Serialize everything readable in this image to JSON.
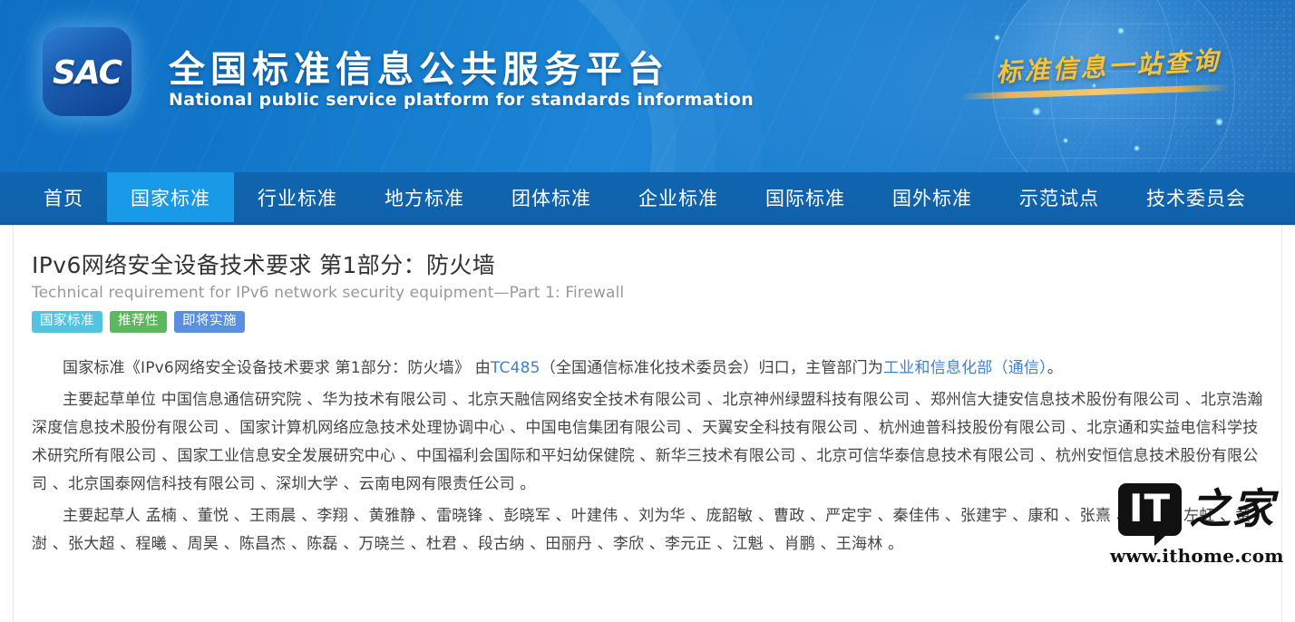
{
  "header": {
    "logo_text": "SAC",
    "title_cn": "全国标准信息公共服务平台",
    "title_en": "National public service platform  for standards information",
    "slogan_cn": "标准信息一站查询"
  },
  "nav": {
    "items": [
      {
        "label": "首页",
        "active": false
      },
      {
        "label": "国家标准",
        "active": true
      },
      {
        "label": "行业标准",
        "active": false
      },
      {
        "label": "地方标准",
        "active": false
      },
      {
        "label": "团体标准",
        "active": false
      },
      {
        "label": "企业标准",
        "active": false
      },
      {
        "label": "国际标准",
        "active": false
      },
      {
        "label": "国外标准",
        "active": false
      },
      {
        "label": "示范试点",
        "active": false
      },
      {
        "label": "技术委员会",
        "active": false
      }
    ]
  },
  "document": {
    "title": "IPv6网络安全设备技术要求 第1部分：防火墙",
    "subtitle": "Technical requirement for IPv6 network security equipment—Part 1: Firewall",
    "badges": [
      {
        "label": "国家标准",
        "color": "#52c3e0"
      },
      {
        "label": "推荐性",
        "color": "#5cb85c"
      },
      {
        "label": "即将实施",
        "color": "#5b8fe0"
      }
    ],
    "paragraphs": [
      {
        "name": "scope-paragraph",
        "segments": [
          {
            "text": "国家标准《IPv6网络安全设备技术要求 第1部分：防火墙》 由",
            "link": false
          },
          {
            "text": "TC485",
            "link": true
          },
          {
            "text": "（全国通信标准化技术委员会）归口，主管部门为",
            "link": false
          },
          {
            "text": "工业和信息化部（通信）",
            "link": true
          },
          {
            "text": "。",
            "link": false
          }
        ]
      },
      {
        "name": "drafting-organizations-paragraph",
        "segments": [
          {
            "text": "主要起草单位 中国信息通信研究院 、华为技术有限公司 、北京天融信网络安全技术有限公司 、北京神州绿盟科技有限公司 、郑州信大捷安信息技术股份有限公司 、北京浩瀚深度信息技术股份有限公司 、国家计算机网络应急技术处理协调中心 、中国电信集团有限公司 、天翼安全科技有限公司 、杭州迪普科技股份有限公司 、北京通和实益电信科学技术研究所有限公司 、国家工业信息安全发展研究中心 、中国福利会国际和平妇幼保健院 、新华三技术有限公司 、北京可信华泰信息技术有限公司 、杭州安恒信息技术股份有限公司 、北京国泰网信科技有限公司 、深圳大学 、云南电网有限责任公司 。",
            "link": false
          }
        ]
      },
      {
        "name": "drafters-paragraph",
        "segments": [
          {
            "text": "主要起草人 孟楠 、董悦 、王雨晨 、李翔 、黄雅静 、雷晓锋 、彭晓军 、叶建伟 、刘为华 、庞韶敏 、曹政 、严定宇 、秦佳伟 、张建宇 、康和 、张熹 、吴庆 、左虹 、黄澍 、张大超 、程曦 、周昊 、陈昌杰 、陈磊 、万晓兰 、杜君 、段古纳 、田丽丹 、李欣 、李元正 、江魁 、肖鹏 、王海林 。",
            "link": false
          }
        ]
      }
    ]
  },
  "watermark": {
    "mark_text": "IT",
    "mark_cn": "之家",
    "url": "www.ithome.com"
  },
  "colors": {
    "nav_bg": "#0f61aa",
    "nav_active": "#189ae8",
    "link": "#3d82d4",
    "slogan_gold": "#f7c33c"
  }
}
